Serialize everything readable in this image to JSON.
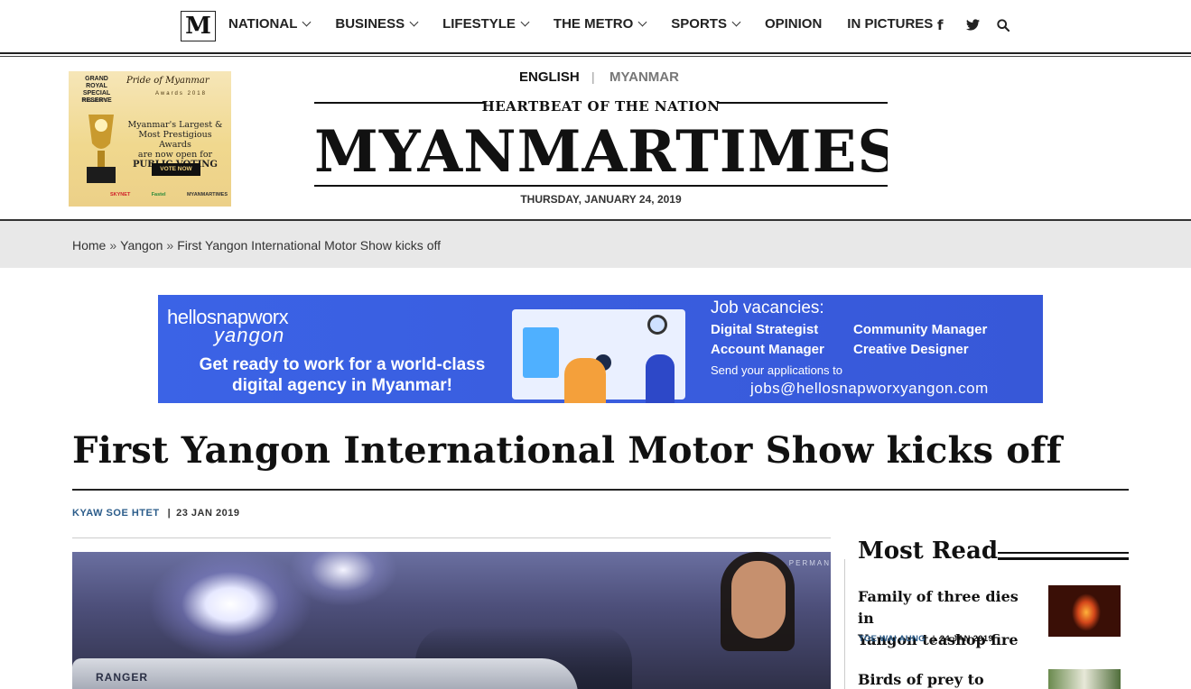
{
  "nav": {
    "logo": "M",
    "items": [
      {
        "label": "NATIONAL",
        "has_dropdown": true
      },
      {
        "label": "BUSINESS",
        "has_dropdown": true
      },
      {
        "label": "LIFESTYLE",
        "has_dropdown": true
      },
      {
        "label": "THE METRO",
        "has_dropdown": true
      },
      {
        "label": "SPORTS",
        "has_dropdown": true
      },
      {
        "label": "OPINION",
        "has_dropdown": false
      },
      {
        "label": "IN PICTURES",
        "has_dropdown": false
      }
    ],
    "social": {
      "facebook": "f",
      "twitter": "twitter-icon",
      "search": "search-icon"
    }
  },
  "header": {
    "lang_english": "ENGLISH",
    "lang_sep": "|",
    "lang_myanmar": "MYANMAR",
    "tagline": "HEARTBEAT OF THE NATION",
    "masthead": "MYANMARTIMES",
    "date": "THURSDAY, JANUARY 24, 2019"
  },
  "left_ad": {
    "brand": "GRAND ROYAL SPECIAL RESERVE",
    "presents": "PRESENTS",
    "pride": "Pride of Myanmar",
    "awards": "Awards 2018",
    "line1": "Myanmar's Largest &",
    "line2": "Most Prestigious Awards",
    "line3": "are now open for",
    "line4": "PUBLIC VOTING",
    "vote": "VOTE NOW",
    "sponsor1": "SKYNET",
    "sponsor2": "Fastel",
    "sponsor3": "MYANMARTIMES"
  },
  "breadcrumb": {
    "home": "Home",
    "sep": "»",
    "section": "Yangon",
    "current": "First Yangon International Motor Show kicks off"
  },
  "banner": {
    "logo_top": "hellosnapworx",
    "logo_bottom": "yangon",
    "headline1": "Get ready to work for a world-class",
    "headline2": "digital agency in Myanmar!",
    "jobs_title": "Job vacancies:",
    "role1": "Digital Strategist",
    "role2": "Community Manager",
    "role3": "Account Manager",
    "role4": "Creative Designer",
    "send": "Send your applications to",
    "email": "jobs@hellosnapworxyangon.com"
  },
  "article": {
    "headline": "First Yangon International Motor Show kicks off",
    "author": "KYAW SOE HTET",
    "sep": "|",
    "date": "23 JAN 2019",
    "hero_text": "RANGER",
    "hero_sign": "PERMAN"
  },
  "sidebar": {
    "title": "Most Read",
    "items": [
      {
        "title_line1": "Family of three dies in",
        "title_line2": "Yangon teashop fire",
        "author": "TOE WAI AUNG",
        "sep": "|",
        "date": "24 JAN 2019"
      },
      {
        "title_line1": "Birds of prey to regale",
        "title_line2": "",
        "author": "",
        "sep": "",
        "date": ""
      }
    ]
  },
  "colors": {
    "link_blue": "#2b5c8a",
    "banner_blue": "#3b63e6",
    "crumb_bg": "#e8e8e8"
  }
}
